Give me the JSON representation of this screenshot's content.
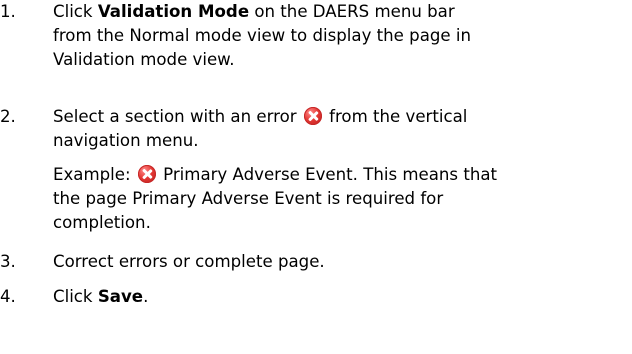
{
  "steps": {
    "s1": {
      "number": "1.",
      "line1_prefix": "Click ",
      "line1_bold": "Validation Mode",
      "line1_suffix": " on the DAERS menu bar",
      "line2": "from the Normal mode view to display the page in",
      "line3": "Validation mode view."
    },
    "s2": {
      "number": "2.",
      "line1_prefix": "Select a section with an error ",
      "error_icon": "error-x-icon",
      "line1_suffix": " from the vertical",
      "line2": "navigation menu."
    },
    "example": {
      "line1_prefix": "Example: ",
      "error_icon": "error-x-icon",
      "line1_suffix": " Primary Adverse Event. This means that",
      "line2": "the page Primary Adverse Event is required for",
      "line3": "completion."
    },
    "s3": {
      "number": "3.",
      "text": "Correct errors or complete page."
    },
    "s4": {
      "number": "4.",
      "prefix": "Click ",
      "bold": "Save",
      "suffix": "."
    }
  },
  "colors": {
    "text": "#000000",
    "error_icon": "#e53935"
  }
}
